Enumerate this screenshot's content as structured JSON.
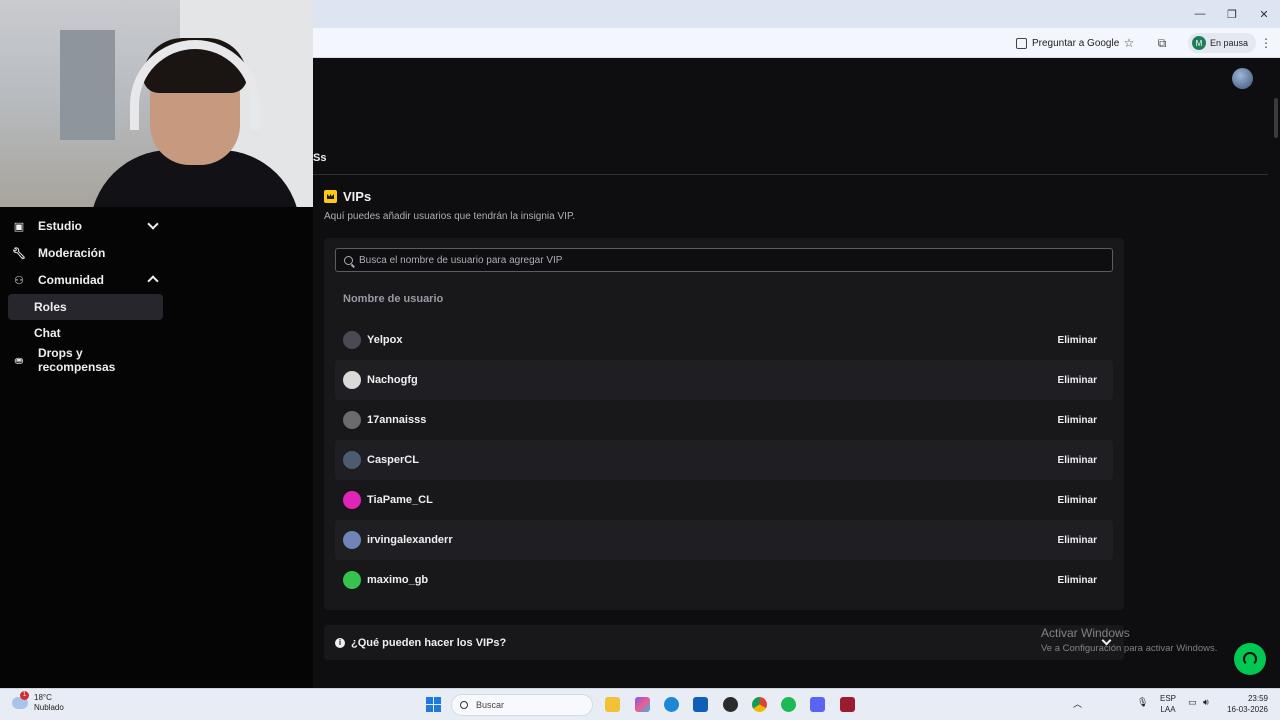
{
  "browser": {
    "ask_google": "Preguntar a Google",
    "profile_initial": "M",
    "profile_status": "En pausa"
  },
  "header": {
    "fragment_text": "Ss"
  },
  "sidebar": {
    "items": [
      {
        "label": "Estudio",
        "icon": "video-icon"
      },
      {
        "label": "Moderación",
        "icon": "wrench-icon"
      },
      {
        "label": "Comunidad",
        "icon": "people-icon"
      },
      {
        "label": "Drops y recompensas",
        "icon": "gift-icon"
      }
    ],
    "subitems": [
      {
        "label": "Roles",
        "active": true
      },
      {
        "label": "Chat",
        "active": false
      }
    ]
  },
  "vips": {
    "title": "VIPs",
    "description": "Aquí puedes añadir usuarios que tendrán la insignia VIP.",
    "search_placeholder": "Busca el nombre de usuario para agregar VIP",
    "column_header": "Nombre de usuario",
    "remove_label": "Eliminar",
    "users": [
      {
        "name": "Yelpox",
        "avatar_color": "#4a4a55"
      },
      {
        "name": "Nachogfg",
        "avatar_color": "#d9d9d9"
      },
      {
        "name": "17annaisss",
        "avatar_color": "#6b6b6b"
      },
      {
        "name": "CasperCL",
        "avatar_color": "#4d5b70"
      },
      {
        "name": "TiaPame_CL",
        "avatar_color": "#e024b8"
      },
      {
        "name": "irvingalexanderr",
        "avatar_color": "#6f85b8"
      },
      {
        "name": "maximo_gb",
        "avatar_color": "#35c24f"
      }
    ],
    "faq_label": "¿Qué pueden hacer los VIPs?"
  },
  "watermark": {
    "line1": "Activar Windows",
    "line2": "Ve a Configuración para activar Windows."
  },
  "taskbar": {
    "temperature": "18°C",
    "weather": "Nublado",
    "search_label": "Buscar",
    "lang_top": "ESP",
    "lang_bottom": "LAA",
    "time": "23:59",
    "date": "16-03-2026"
  },
  "colors": {
    "accent_vip": "#ffc719",
    "help_button": "#00c853",
    "background": "#0e0e10",
    "card": "#18181b"
  }
}
